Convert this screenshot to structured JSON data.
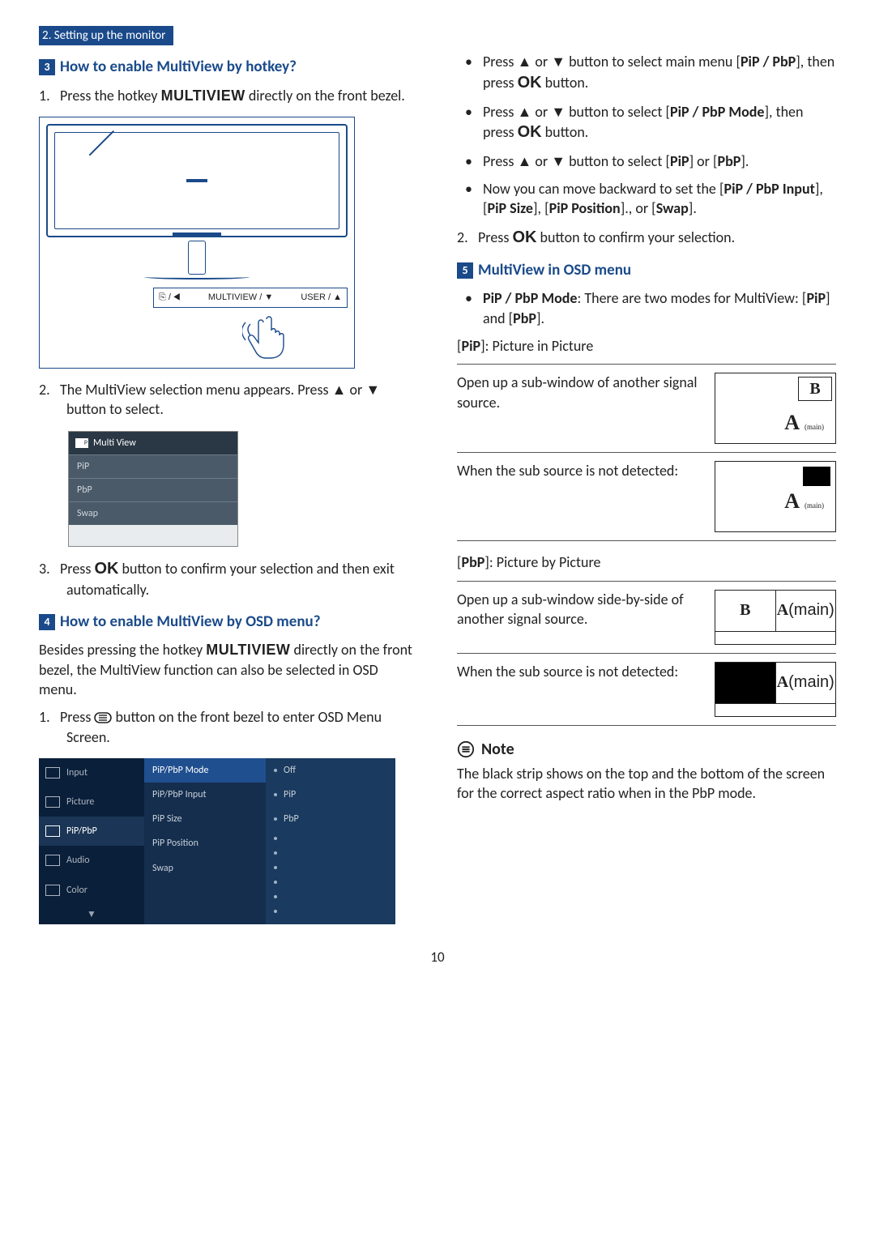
{
  "section_tag": "2. Setting up the monitor",
  "left": {
    "q3_num": "3",
    "q3": "How to enable MultiView by hotkey?",
    "step1_n": "1.",
    "step1": "Press the hotkey MULTIVIEW directly on the front bezel.",
    "bezel": {
      "b1": "⎘ / ◀",
      "b2": "MULTIVIEW / ▼",
      "b3": "USER / ▲"
    },
    "step2_n": "2.",
    "step2a": "The MultiView selection menu appears. Press ",
    "step2b": " or ",
    "step2c": " button to select.",
    "osd_small": {
      "title": "Multi View",
      "r1": "PiP",
      "r2": "PbP",
      "r3": "Swap"
    },
    "step3_n": "3.",
    "step3a": "Press ",
    "step3b": " button to confirm your selection and then exit automatically.",
    "q4_num": "4",
    "q4": "How to enable MultiView by OSD menu?",
    "q4_intro": "Besides pressing the hotkey MULTIVIEW directly on the front bezel,  the MultiView function can also be selected in OSD menu.",
    "s1_n": "1.",
    "s1a": "Press ",
    "s1b": " button on the front bezel to enter OSD Menu Screen.",
    "osd_big": {
      "left": {
        "input": "Input",
        "picture": "Picture",
        "pip": "PiP/PbP",
        "audio": "Audio",
        "color": "Color"
      },
      "mid": {
        "m1": "PiP/PbP Mode",
        "m2": "PiP/PbP Input",
        "m3": "PiP Size",
        "m4": "PiP Position",
        "m5": "Swap"
      },
      "right": {
        "r1": "Off",
        "r2": "PiP",
        "r3": "PbP"
      }
    }
  },
  "right": {
    "b1a": "Press ",
    "b1b": " or ",
    "b1c": " button to select main menu [",
    "b1d": "PiP / PbP",
    "b1e": "], then press ",
    "b1f": " button.",
    "b2a": "Press ",
    "b2b": " or ",
    "b2c": " button to select [",
    "b2d": "PiP / PbP Mode",
    "b2e": "], then press ",
    "b2f": " button.",
    "b3a": "Press ",
    "b3b": " or ",
    "b3c": " button to select [",
    "b3d": "PiP",
    "b3e": "] or [",
    "b3f": "PbP",
    "b3g": "].",
    "b4a": "Now you can move backward to set the [",
    "b4b": "PiP / PbP Input",
    "b4c": "], [",
    "b4d": "PiP Size",
    "b4e": "], [",
    "b4f": "PiP Position",
    "b4g": "]., or [",
    "b4h": "Swap",
    "b4i": "].",
    "n2": "2.",
    "n2a": "Press ",
    "n2b": " button to confirm your selection.",
    "q5_num": "5",
    "q5": "MultiView in OSD menu",
    "m1a": "PiP / PbP Mode",
    "m1b": ": There are two modes for MultiView: [",
    "m1c": "PiP",
    "m1d": "] and [",
    "m1e": "PbP",
    "m1f": "].",
    "pip_label_a": "[",
    "pip_label_b": "PiP",
    "pip_label_c": "]: Picture in Picture",
    "pip1": "Open up a sub-window of another signal source.",
    "pip2": "When the sub source is not detected:",
    "B": "B",
    "A": "A",
    "main_small": "(main)",
    "pbp_label_a": "[",
    "pbp_label_b": "PbP",
    "pbp_label_c": "]: Picture by Picture",
    "pbp1": "Open up a sub-window side-by-side of another signal source.",
    "pbp2": "When the sub source is not detected:",
    "note": "Note",
    "note_body": "The black strip shows on the top and the bottom of the screen for the correct aspect ratio when in the PbP mode."
  },
  "page_number": "10"
}
